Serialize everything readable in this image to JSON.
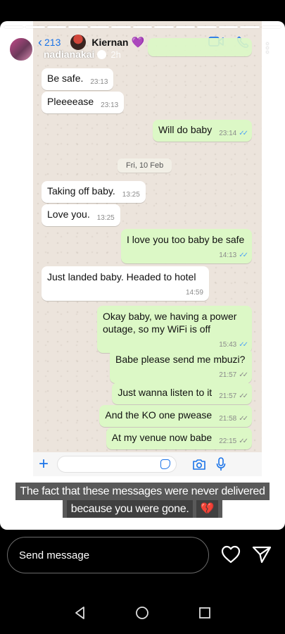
{
  "chat": {
    "back_count": "213",
    "contact_name": "Kiernan",
    "contact_emoji": "💜"
  },
  "story": {
    "username": "nadianakai",
    "time": "2h",
    "caption_line1": "The fact that these messages were never delivered",
    "caption_line2": "because you were gone.",
    "caption_emoji": "💔"
  },
  "messages": [
    {
      "dir": "in",
      "text": "Be safe.",
      "time": "23:13"
    },
    {
      "dir": "in",
      "text": "Pleeeease",
      "time": "23:13"
    },
    {
      "dir": "out",
      "text": "Will do baby",
      "time": "23:14"
    },
    {
      "dir": "in",
      "text": "Taking off baby.",
      "time": "13:25"
    },
    {
      "dir": "in",
      "text": "Love you.",
      "time": "13:25"
    },
    {
      "dir": "out",
      "text": "I love you too baby be safe",
      "time": "14:13"
    },
    {
      "dir": "in",
      "text": "Just landed baby. Headed to hotel",
      "time": "14:59"
    },
    {
      "dir": "out",
      "text": "Okay baby, we having a power outage, so my WiFi is off",
      "time": "15:43"
    },
    {
      "dir": "out",
      "text": "Babe please send me mbuzi?",
      "time": "21:57"
    },
    {
      "dir": "out",
      "text": "Just wanna listen to it",
      "time": "21:57"
    },
    {
      "dir": "out",
      "text": "And the KO one pwease",
      "time": "21:58"
    },
    {
      "dir": "out",
      "text": "At my venue now babe",
      "time": "22:15"
    }
  ],
  "date_divider": "Fri, 10 Feb",
  "reply": {
    "placeholder": "Send message"
  },
  "colors": {
    "outgoing_bubble": "#dcf8c6",
    "incoming_bubble": "#ffffff",
    "accent": "#1a73e8",
    "read_ticks": "#4fa3f5"
  }
}
